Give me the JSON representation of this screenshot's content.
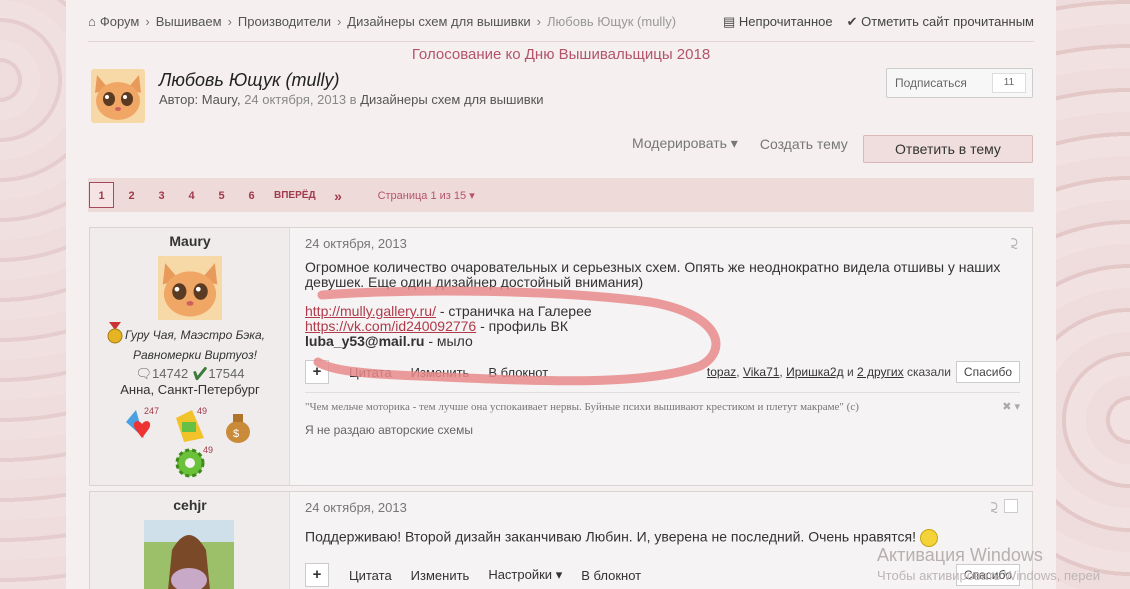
{
  "breadcrumb": {
    "items": [
      "Форум",
      "Вышиваем",
      "Производители",
      "Дизайнеры схем для вышивки",
      "Любовь Ющук (mully)"
    ],
    "unread": "Непрочитанное",
    "mark_read": "Отметить сайт прочитанным"
  },
  "banner": "Голосование ко Дню Вышивальщицы 2018",
  "topic": {
    "title": "Любовь Ющук (mully)",
    "author_prefix": "Автор:",
    "author": "Maury",
    "date": "24 октября, 2013",
    "in_text": "в",
    "forum": "Дизайнеры схем для вышивки",
    "follow_label": "Подписаться",
    "follow_count": "11"
  },
  "actions": {
    "moderate": "Модерировать",
    "create": "Создать тему",
    "reply": "Ответить в тему"
  },
  "pagination": {
    "pages": [
      "1",
      "2",
      "3",
      "4",
      "5",
      "6"
    ],
    "next": "ВПЕРЁД",
    "last": "»",
    "info": "Страница 1 из 15"
  },
  "posts": [
    {
      "author": "Maury",
      "rank": "Гуру Чая, Маэстро Бэка, Равномерки Виртуоз!",
      "posts_count": "14742",
      "rep": "17544",
      "location": "Анна, Санкт-Петербург",
      "awards": [
        "247",
        "49",
        "49"
      ],
      "date": "24 октября, 2013",
      "text": "Огромное количество очаровательных и серьезных схем. Опять же неоднократно видела отшивы у наших девушек. Еще один дизайнер достойный внимания)",
      "link1": "http://mully.gallery.ru/",
      "link1_desc": " - страничка на Галерее",
      "link2": "https://vk.com/id240092776",
      "link2_desc": " - профиль ВК",
      "email": "luba_y53@mail.ru",
      "email_desc": " - мыло",
      "quote": "Цитата",
      "edit": "Изменить",
      "notebook": "В блокнот",
      "liked_by": [
        "topaz",
        "Vika71",
        "Иришка2д"
      ],
      "and_text": "и",
      "others": "2 других",
      "said_text": "сказали",
      "thanks": "Спасибо",
      "signature": "\"Чем мельче моторика - тем лучше она успокаивает нервы. Буйные психи вышивают крестиком и плетут макраме\" (с)",
      "signature2": "Я не раздаю авторские схемы"
    },
    {
      "author": "cehjr",
      "date": "24 октября, 2013",
      "text": "Поддерживаю! Второй дизайн заканчиваю Любин. И, уверена не последний. Очень нравятся!",
      "quote": "Цитата",
      "edit": "Изменить",
      "settings": "Настройки",
      "notebook": "В блокнот",
      "thanks": "Спасибо"
    }
  ],
  "watermark": {
    "title": "Активация Windows",
    "subtitle": "Чтобы активировать Windows, перей"
  }
}
